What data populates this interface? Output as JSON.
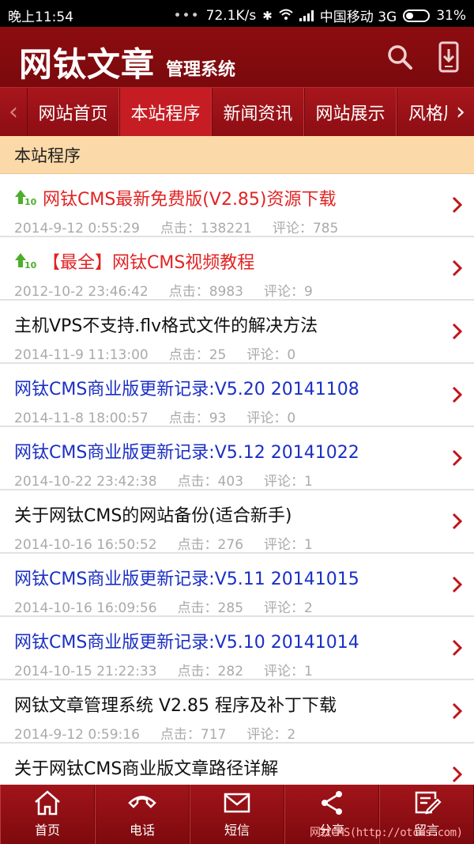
{
  "status_bar": {
    "time": "晚上11:54",
    "speed": "72.1K/s",
    "carrier": "中国移动 3G",
    "battery": "31%"
  },
  "header": {
    "logo_main": "网钛文章",
    "logo_sub": "管理系统",
    "icons": [
      "search-icon",
      "phone-download-icon"
    ]
  },
  "nav": {
    "tabs": [
      {
        "label": "网站首页"
      },
      {
        "label": "本站程序",
        "active": true
      },
      {
        "label": "新闻资讯"
      },
      {
        "label": "网站展示"
      },
      {
        "label": "风格展示"
      }
    ]
  },
  "section": {
    "title": "本站程序"
  },
  "list": [
    {
      "title": "网钛CMS最新免费版(V2.85)资源下载",
      "color": "red",
      "top": true,
      "date": "2014-9-12 0:55:29",
      "clicks": "点击：138221",
      "comments": "评论：785"
    },
    {
      "title": "【最全】网钛CMS视频教程",
      "color": "red",
      "top": true,
      "date": "2012-10-2 23:46:42",
      "clicks": "点击：8983",
      "comments": "评论：9"
    },
    {
      "title": "主机VPS不支持.flv格式文件的解决方法",
      "color": "black",
      "top": false,
      "date": "2014-11-9 11:13:00",
      "clicks": "点击：25",
      "comments": "评论：0"
    },
    {
      "title": "网钛CMS商业版更新记录:V5.20 20141108",
      "color": "blue",
      "top": false,
      "date": "2014-11-8 18:00:57",
      "clicks": "点击：93",
      "comments": "评论：0"
    },
    {
      "title": "网钛CMS商业版更新记录:V5.12 20141022",
      "color": "blue",
      "top": false,
      "date": "2014-10-22 23:42:38",
      "clicks": "点击：403",
      "comments": "评论：1"
    },
    {
      "title": "关于网钛CMS的网站备份(适合新手)",
      "color": "black",
      "top": false,
      "date": "2014-10-16 16:50:52",
      "clicks": "点击：276",
      "comments": "评论：1"
    },
    {
      "title": "网钛CMS商业版更新记录:V5.11 20141015",
      "color": "blue",
      "top": false,
      "date": "2014-10-16 16:09:56",
      "clicks": "点击：285",
      "comments": "评论：2"
    },
    {
      "title": "网钛CMS商业版更新记录:V5.10 20141014",
      "color": "blue",
      "top": false,
      "date": "2014-10-15 21:22:33",
      "clicks": "点击：282",
      "comments": "评论：1"
    },
    {
      "title": "网钛文章管理系统 V2.85 程序及补丁下载",
      "color": "black",
      "top": false,
      "date": "2014-9-12 0:59:16",
      "clicks": "点击：717",
      "comments": "评论：2"
    },
    {
      "title": "关于网钛CMS商业版文章路径详解",
      "color": "black",
      "top": false,
      "date": "",
      "clicks": "",
      "comments": ""
    }
  ],
  "bottom_bar": [
    {
      "label": "首页",
      "icon": "home-icon"
    },
    {
      "label": "电话",
      "icon": "phone-icon"
    },
    {
      "label": "短信",
      "icon": "mail-icon"
    },
    {
      "label": "分享",
      "icon": "share-icon"
    },
    {
      "label": "留言",
      "icon": "edit-icon"
    }
  ],
  "watermark": "网钛CMS(http://otcms.com)",
  "colors": {
    "brand": "#8d0c10",
    "active_tab": "#c51d23",
    "section_bg": "#fcd9a8",
    "title_red": "#e12323",
    "title_blue": "#1a2fc4"
  }
}
